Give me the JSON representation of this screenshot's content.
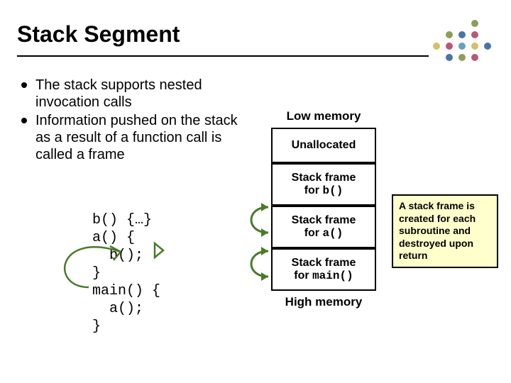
{
  "title": "Stack Segment",
  "bullets": {
    "items": [
      "The stack supports nested invocation calls",
      "Information pushed on the stack as a result of a function call is called a frame"
    ]
  },
  "code": "b() {…}\na() {\n  b();\n}\nmain() {\n  a();\n}",
  "memory": {
    "low_label": "Low memory",
    "high_label": "High memory",
    "cells": [
      {
        "line1": "Unallocated",
        "mono": ""
      },
      {
        "line1": "Stack frame",
        "line2_prefix": "for ",
        "mono": "b()"
      },
      {
        "line1": "Stack frame",
        "line2_prefix": "for ",
        "mono": "a()"
      },
      {
        "line1": "Stack frame",
        "line2_prefix": "for ",
        "mono": "main()"
      }
    ]
  },
  "note": "A stack frame is created for each subroutine and destroyed upon return"
}
